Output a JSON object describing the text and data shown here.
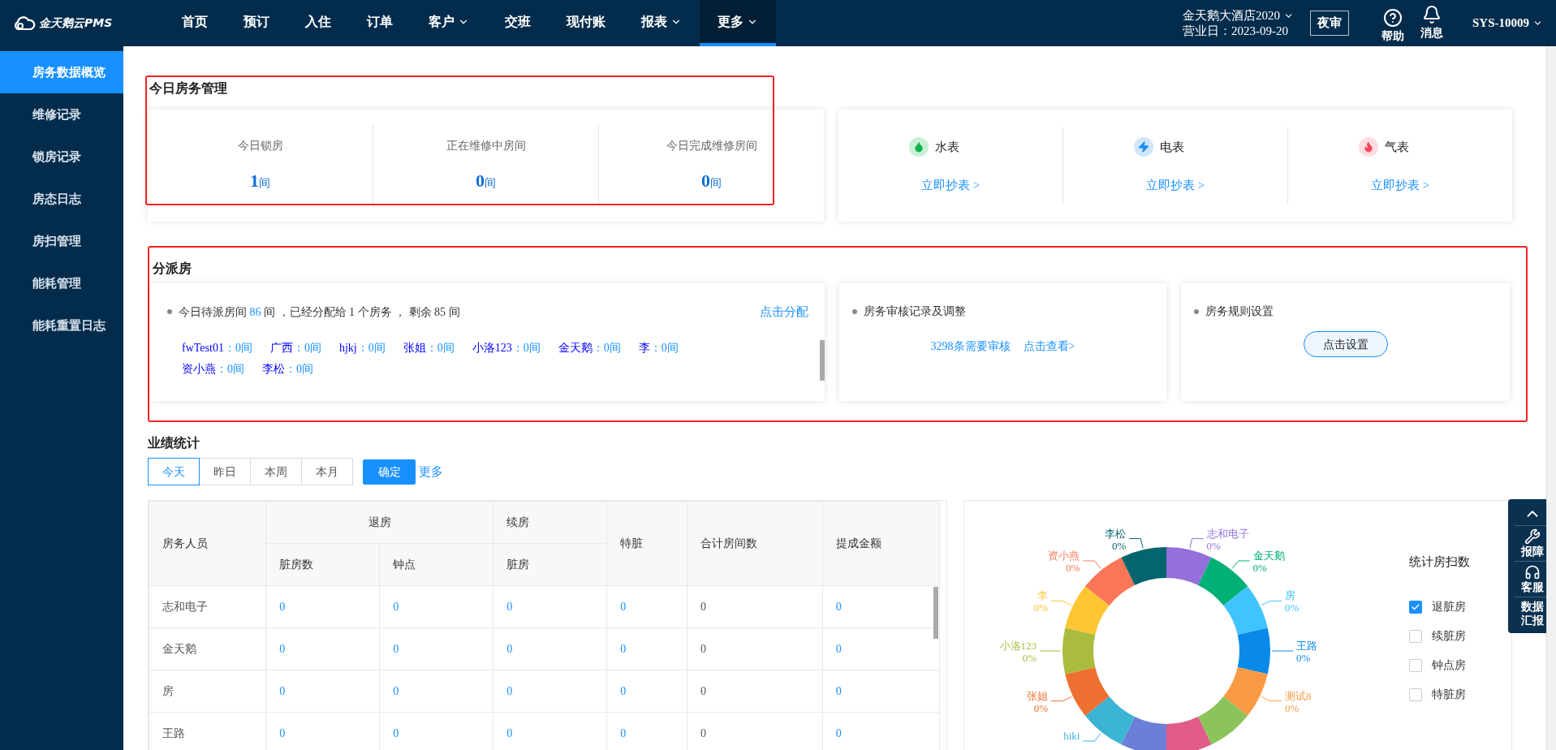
{
  "brand": "金天鹅云PMS",
  "nav": [
    {
      "label": "首页",
      "dropdown": false,
      "selected": false
    },
    {
      "label": "预订",
      "dropdown": false,
      "selected": false
    },
    {
      "label": "入住",
      "dropdown": false,
      "selected": false
    },
    {
      "label": "订单",
      "dropdown": false,
      "selected": false
    },
    {
      "label": "客户",
      "dropdown": true,
      "selected": false
    },
    {
      "label": "交班",
      "dropdown": false,
      "selected": false
    },
    {
      "label": "现付账",
      "dropdown": false,
      "selected": false
    },
    {
      "label": "报表",
      "dropdown": true,
      "selected": false
    },
    {
      "label": "更多",
      "dropdown": true,
      "selected": true
    }
  ],
  "hotel": {
    "name": "金天鹅大酒店2020",
    "business_date": "营业日：2023-09-20"
  },
  "night_audit": "夜审",
  "help": "帮助",
  "messages": "消息",
  "user": "SYS-10009",
  "sidebar": [
    {
      "label": "房务数据概览",
      "selected": true
    },
    {
      "label": "维修记录",
      "selected": false
    },
    {
      "label": "锁房记录",
      "selected": false
    },
    {
      "label": "房态日志",
      "selected": false
    },
    {
      "label": "房扫管理",
      "selected": false
    },
    {
      "label": "能耗管理",
      "selected": false
    },
    {
      "label": "能耗重置日志",
      "selected": false
    }
  ],
  "today": {
    "title": "今日房务管理",
    "stats": [
      {
        "label": "今日锁房",
        "value": "1",
        "unit": "间"
      },
      {
        "label": "正在维修中房间",
        "value": "0",
        "unit": "间"
      },
      {
        "label": "今日完成维修房间",
        "value": "0",
        "unit": "间"
      }
    ]
  },
  "meters": [
    {
      "kind": "water",
      "label": "水表",
      "link": "立即抄表 >"
    },
    {
      "kind": "power",
      "label": "电表",
      "link": "立即抄表 >"
    },
    {
      "kind": "gas",
      "label": "气表",
      "link": "立即抄表 >"
    }
  ],
  "dispatch": {
    "title": "分派房",
    "pending_prefix": "今日待派房间",
    "pending_count": "86",
    "pending_suffix": "间 ，已经分配给 1 个房务 ， 剩余 85 间",
    "assign_link": "点击分配",
    "staff": [
      {
        "name": "fwTest01",
        "count": "：0间"
      },
      {
        "name": "广西",
        "count": "：0间"
      },
      {
        "name": "hjkj",
        "count": "：0间"
      },
      {
        "name": "张姐",
        "count": "：0间"
      },
      {
        "name": "小洛123",
        "count": "：0间"
      },
      {
        "name": "金天鹅",
        "count": "：0间"
      },
      {
        "name": "李",
        "count": "：0间"
      },
      {
        "name": "资小燕",
        "count": "：0间"
      },
      {
        "name": "李松",
        "count": "：0间"
      }
    ],
    "review": {
      "title": "房务审核记录及调整",
      "count": "3298条需要审核",
      "link": "点击查看>"
    },
    "rules": {
      "title": "房务规则设置",
      "button": "点击设置"
    }
  },
  "performance": {
    "title": "业绩统计",
    "periods": [
      {
        "label": "今天",
        "selected": true
      },
      {
        "label": "昨日",
        "selected": false
      },
      {
        "label": "本周",
        "selected": false
      },
      {
        "label": "本月",
        "selected": false
      }
    ],
    "confirm": "确定",
    "more": "更多",
    "columns": [
      {
        "label": "房务人员",
        "link": false
      },
      {
        "label": "退房",
        "colspan": 2,
        "children": [
          {
            "label": "脏房数",
            "link": true
          },
          {
            "label": "钟点",
            "link": true
          }
        ]
      },
      {
        "label": "续房",
        "children": [
          {
            "label": "脏房",
            "link": true
          }
        ]
      },
      {
        "label": "特脏",
        "link": true
      },
      {
        "label": "合计房间数",
        "link": false
      },
      {
        "label": "提成金额",
        "link": true
      }
    ],
    "rows": [
      [
        "志和电子",
        "0",
        "0",
        "0",
        "0",
        "0",
        "0"
      ],
      [
        "金天鹅",
        "0",
        "0",
        "0",
        "0",
        "0",
        "0"
      ],
      [
        "房",
        "0",
        "0",
        "0",
        "0",
        "0",
        "0"
      ],
      [
        "王路",
        "0",
        "0",
        "0",
        "0",
        "0",
        "0"
      ]
    ]
  },
  "chart": {
    "slices": [
      {
        "name": "志和电子",
        "pct": "0%",
        "color": "#9370db"
      },
      {
        "name": "金天鹅",
        "pct": "0%",
        "color": "#00b074"
      },
      {
        "name": "房",
        "pct": "0%",
        "color": "#40c4ff"
      },
      {
        "name": "王路",
        "pct": "0%",
        "color": "#0a8ae8"
      },
      {
        "name": "测试8",
        "pct": "0%",
        "color": "#fb9a45"
      },
      {
        "color": "#8bc45a"
      },
      {
        "color": "#e05a8a"
      },
      {
        "color": "#6b7fd7"
      },
      {
        "name": "hiki",
        "color": "#3cb4d4"
      },
      {
        "name": "张姐",
        "pct": "0%",
        "color": "#ee7030"
      },
      {
        "name": "小洛123",
        "pct": "0%",
        "color": "#aabb3e"
      },
      {
        "name": "李",
        "pct": "0%",
        "color": "#ffc533"
      },
      {
        "name": "资小燕",
        "pct": "0%",
        "color": "#fa7658"
      },
      {
        "name": "李松",
        "pct": "0%",
        "color": "#05656e"
      }
    ],
    "legend_title": "统计房扫数",
    "options": [
      {
        "label": "退脏房",
        "checked": true
      },
      {
        "label": "续脏房",
        "checked": false
      },
      {
        "label": "钟点房",
        "checked": false
      },
      {
        "label": "特脏房",
        "checked": false
      }
    ]
  },
  "float_tools": [
    {
      "kind": "top"
    },
    {
      "kind": "repair",
      "label": "报障"
    },
    {
      "kind": "service",
      "label": "客服"
    },
    {
      "kind": "report",
      "label": "数据汇报"
    }
  ]
}
